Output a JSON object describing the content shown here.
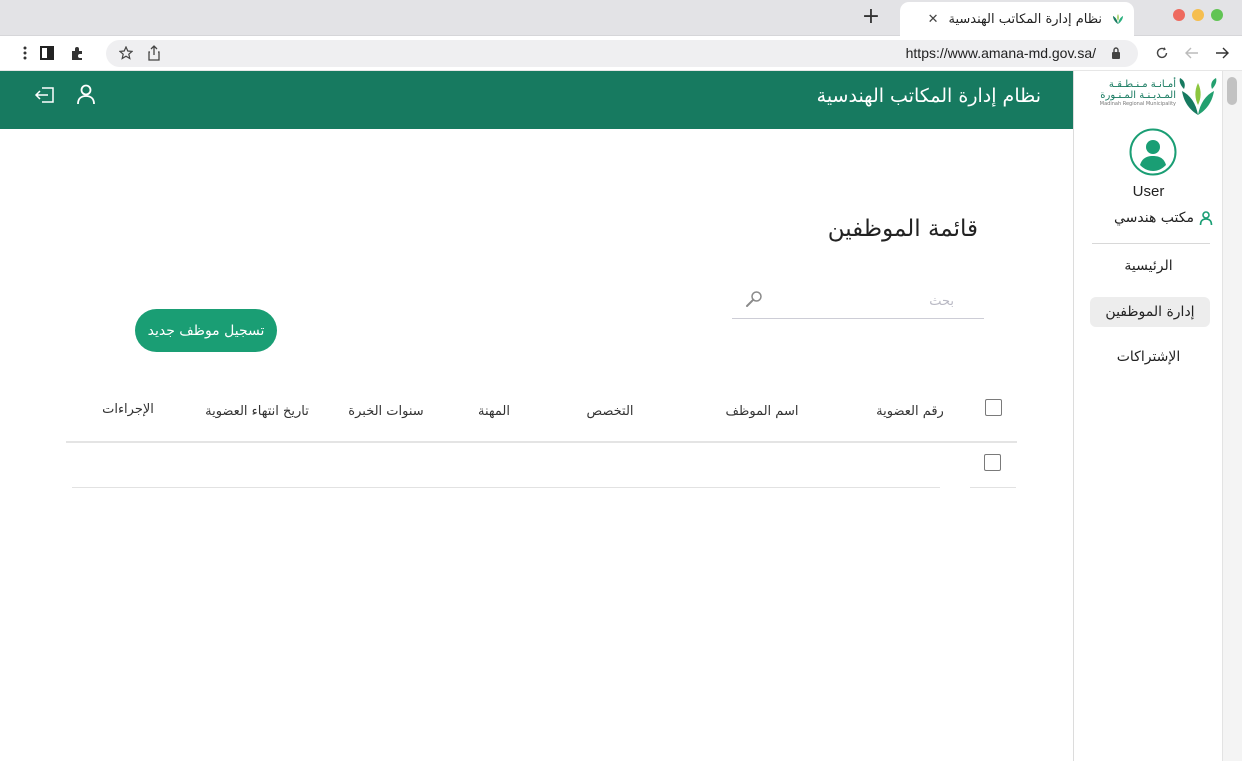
{
  "browser": {
    "tab_title": "نظام إدارة المكاتب الهندسية",
    "url": "https://www.amana-md.gov.sa/",
    "traffic_colors": {
      "close": "#ee6a5f",
      "minimize": "#f5be4f",
      "maximize": "#61c454"
    }
  },
  "header": {
    "title": "نظام إدارة المكاتب الهندسية",
    "background": "#177a60"
  },
  "sidebar": {
    "logo": {
      "line1": "أمـانـة مـنـطـقـة",
      "line2": "المـديـنـة المـنـورة",
      "line3": "Madinah Regional Municipality"
    },
    "user_name": "User",
    "role": "مكتب هندسي",
    "nav": [
      {
        "label": "الرئيسية",
        "active": false
      },
      {
        "label": "إدارة الموظفين",
        "active": true
      },
      {
        "label": "الإشتراكات",
        "active": false
      }
    ]
  },
  "main": {
    "title": "قائمة الموظفين",
    "search_placeholder": "بحث",
    "add_button": "تسجيل موظف جديد",
    "accent": "#1a9e74",
    "columns": [
      "رقم العضوية",
      "اسم الموظف",
      "التخصص",
      "المهنة",
      "سنوات الخبرة",
      "تاريخ انتهاء العضوية",
      "الإجراءات"
    ]
  }
}
